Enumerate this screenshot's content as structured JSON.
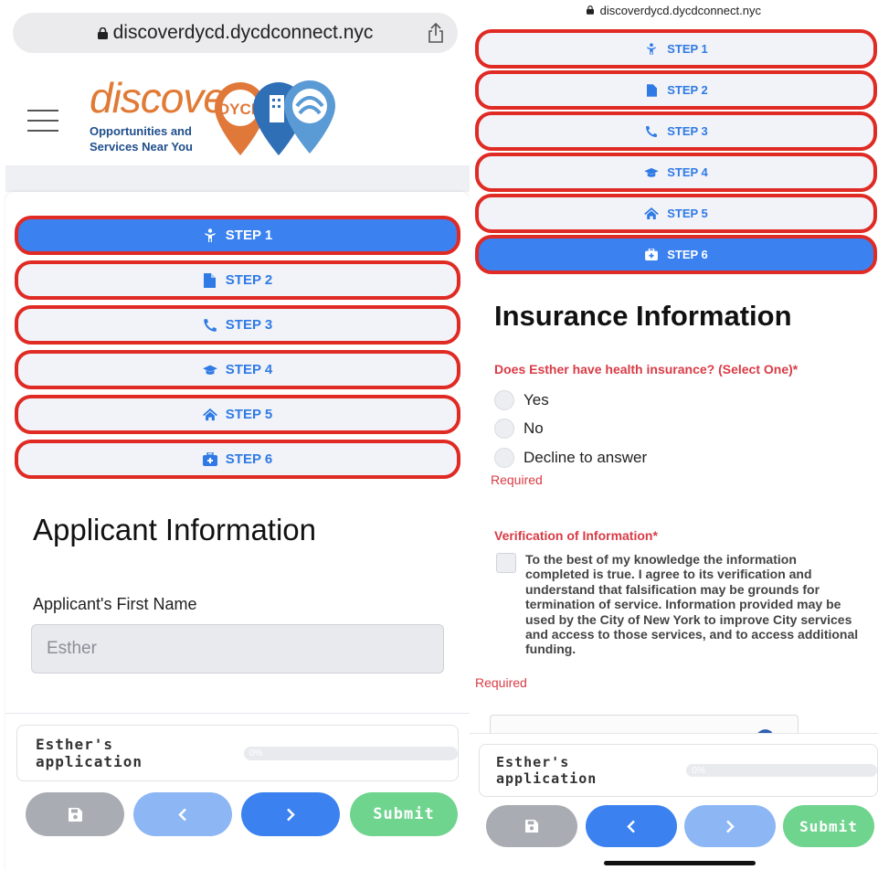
{
  "browser": {
    "url": "discoverdycd.dycdconnect.nyc"
  },
  "logo": {
    "word": "discover",
    "badge": "DYCD",
    "tagline_1": "Opportunities and",
    "tagline_2": "Services Near You"
  },
  "steps": [
    {
      "label": "STEP 1",
      "icon": "child-icon"
    },
    {
      "label": "STEP 2",
      "icon": "file-icon"
    },
    {
      "label": "STEP 3",
      "icon": "phone-icon"
    },
    {
      "label": "STEP 4",
      "icon": "graduation-cap-icon"
    },
    {
      "label": "STEP 5",
      "icon": "home-icon"
    },
    {
      "label": "STEP 6",
      "icon": "medical-kit-icon"
    }
  ],
  "left": {
    "active_step": 1,
    "title": "Applicant Information",
    "first_name_label": "Applicant's First Name",
    "first_name_value": "Esther"
  },
  "right": {
    "active_step": 6,
    "title": "Insurance Information",
    "insurance_question": "Does Esther have health insurance? (Select One)*",
    "options": [
      "Yes",
      "No",
      "Decline to answer"
    ],
    "required_1": "Required",
    "verification_label": "Verification of Information*",
    "verification_text": "To the best of my knowledge the information completed is true. I agree to its verification and understand that falsification may be grounds for termination of service. Information provided may be used by the City of New York to improve City services and access to those services, and to access additional funding.",
    "required_2": "Required"
  },
  "footer": {
    "application_label": "Esther's application",
    "progress_text": "0%",
    "progress_fraction": 0,
    "submit_label": "Submit"
  },
  "colors": {
    "accent": "#3b82f0",
    "accent_light": "#8db7f4",
    "error": "#d93b45",
    "submit": "#6fd48e",
    "step_border": "#e02a24"
  }
}
